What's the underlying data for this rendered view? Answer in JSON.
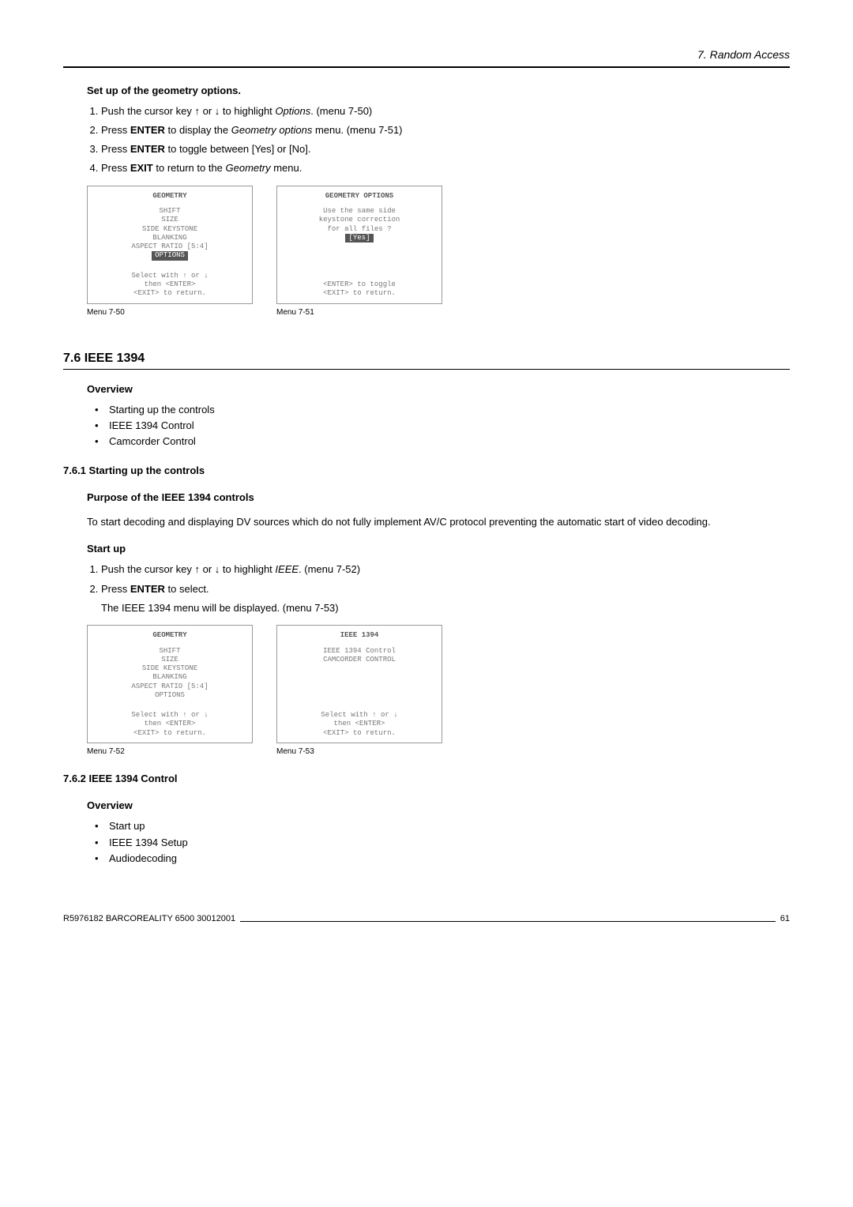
{
  "header": {
    "chapter": "7. Random Access"
  },
  "s1": {
    "title": "Set up of the geometry options.",
    "steps": {
      "1a": "Push the cursor key ",
      "1b": " or ",
      "1c": " to highlight ",
      "1d": "Options",
      "1e": ". (menu 7-50)",
      "2a": "Press ",
      "2b": "ENTER",
      "2c": " to display the ",
      "2d": "Geometry options",
      "2e": " menu. (menu 7-51)",
      "3a": "Press ",
      "3b": "ENTER",
      "3c": " to toggle between [Yes] or [No].",
      "4a": "Press ",
      "4b": "EXIT",
      "4c": " to return to the ",
      "4d": "Geometry",
      "4e": " menu."
    }
  },
  "menu50": {
    "title": "GEOMETRY",
    "i1": "SHIFT",
    "i2": "SIZE",
    "i3": "SIDE KEYSTONE",
    "i4": "BLANKING",
    "i5": "ASPECT RATIO [5:4]",
    "i6": "OPTIONS",
    "f1": "Select with ↑ or ↓",
    "f2": "then <ENTER>",
    "f3": "<EXIT> to return.",
    "caption": "Menu 7-50"
  },
  "menu51": {
    "title": "GEOMETRY OPTIONS",
    "l1": "Use the same side",
    "l2": "keystone correction",
    "l3": "for all files ?",
    "l4": "[Yes]",
    "f1": "<ENTER> to toggle",
    "f2": "<EXIT> to return.",
    "caption": "Menu 7-51"
  },
  "s76": {
    "heading": "7.6 IEEE 1394",
    "overview": "Overview",
    "b1": "Starting up the controls",
    "b2": "IEEE 1394 Control",
    "b3": "Camcorder Control"
  },
  "s761": {
    "heading": "7.6.1 Starting up the controls",
    "purpose_h": "Purpose of the IEEE 1394 controls",
    "purpose_p": "To start decoding and displaying DV sources which do not fully implement AV/C protocol preventing the automatic start of video decoding.",
    "startup_h": "Start up",
    "st1a": "Push the cursor key ",
    "st1b": " or ",
    "st1c": " to highlight ",
    "st1d": "IEEE",
    "st1e": ". (menu 7-52)",
    "st2a": "Press ",
    "st2b": "ENTER",
    "st2c": " to select.",
    "st_after": "The IEEE 1394 menu will be displayed. (menu 7-53)"
  },
  "menu52": {
    "title": "GEOMETRY",
    "i1": "SHIFT",
    "i2": "SIZE",
    "i3": "SIDE KEYSTONE",
    "i4": "BLANKING",
    "i5": "ASPECT RATIO [5:4]",
    "i6": "OPTIONS",
    "f1": "Select with ↑ or ↓",
    "f2": "then <ENTER>",
    "f3": "<EXIT> to return.",
    "caption": "Menu 7-52"
  },
  "menu53": {
    "title": "IEEE 1394",
    "i1": "IEEE 1394 Control",
    "i2": "CAMCORDER CONTROL",
    "f1": "Select with ↑ or ↓",
    "f2": "then <ENTER>",
    "f3": "<EXIT> to return.",
    "caption": "Menu 7-53"
  },
  "s762": {
    "heading": "7.6.2 IEEE 1394 Control",
    "overview": "Overview",
    "b1": "Start up",
    "b2": "IEEE 1394 Setup",
    "b3": "Audiodecoding"
  },
  "footer": {
    "left": "R5976182  BARCOREALITY 6500  30012001",
    "right": "61"
  },
  "glyph": {
    "up": "↑",
    "down": "↓"
  }
}
